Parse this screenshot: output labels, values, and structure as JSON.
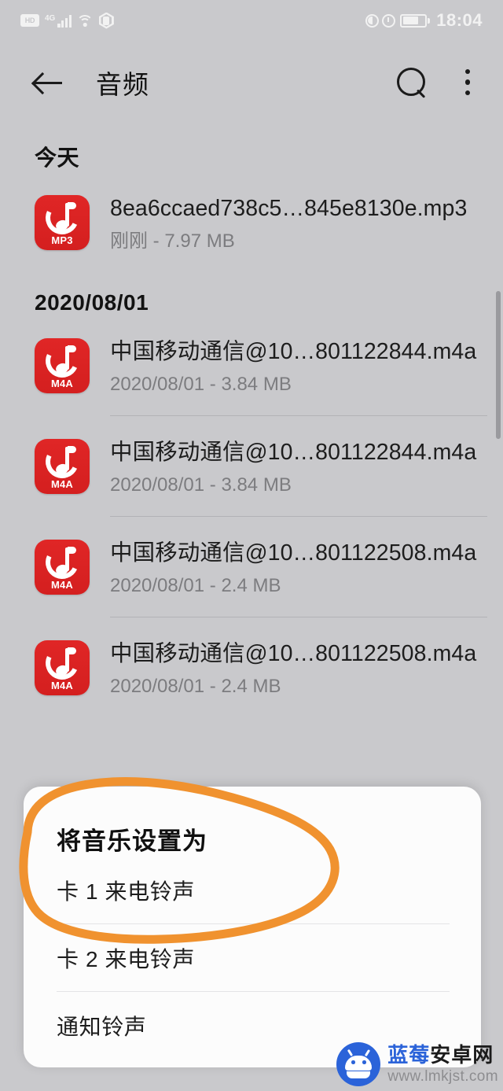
{
  "status_bar": {
    "hd_label": "HD",
    "network": "4G",
    "time": "18:04",
    "icons": [
      "hd-badge-icon",
      "signal-bars-icon",
      "wifi-icon",
      "hexagon-shield-icon",
      "sound-icon",
      "alarm-clock-icon",
      "battery-icon"
    ]
  },
  "app_bar": {
    "title": "音频",
    "back_icon": "back-arrow-icon",
    "search_icon": "search-icon",
    "more_icon": "overflow-menu-icon"
  },
  "sections": [
    {
      "header": "今天",
      "files": [
        {
          "name": "8ea6ccaed738c5…845e8130e.mp3",
          "meta": "刚刚 - 7.97 MB",
          "ext": "MP3",
          "date": "刚刚",
          "size": "7.97 MB"
        }
      ]
    },
    {
      "header": "2020/08/01",
      "files": [
        {
          "name": "中国移动通信@10…801122844.m4a",
          "meta": "2020/08/01 - 3.84 MB",
          "ext": "M4A",
          "date": "2020/08/01",
          "size": "3.84 MB"
        },
        {
          "name": "中国移动通信@10…801122844.m4a",
          "meta": "2020/08/01 - 3.84 MB",
          "ext": "M4A",
          "date": "2020/08/01",
          "size": "3.84 MB"
        },
        {
          "name": "中国移动通信@10…801122508.m4a",
          "meta": "2020/08/01 - 2.4 MB",
          "ext": "M4A",
          "date": "2020/08/01",
          "size": "2.4 MB"
        },
        {
          "name": "中国移动通信@10…801122508.m4a",
          "meta": "2020/08/01 - 2.4 MB",
          "ext": "M4A",
          "date": "2020/08/01",
          "size": "2.4 MB"
        }
      ]
    }
  ],
  "bottom_sheet": {
    "title": "将音乐设置为",
    "options": [
      {
        "label": "卡 1 来电铃声"
      },
      {
        "label": "卡 2 来电铃声"
      },
      {
        "label": "通知铃声"
      }
    ]
  },
  "annotation": {
    "shape": "hand-drawn-oval",
    "color": "#f0922f",
    "targets": [
      "将音乐设置为",
      "卡 1 来电铃声"
    ]
  },
  "watermark": {
    "site_name_part1": "蓝莓",
    "site_name_part2": "安卓网",
    "url": "www.lmkjst.com",
    "logo_icon": "android-robot-icon"
  },
  "colors": {
    "background": "#c9c9cc",
    "sheet": "#fcfcfc",
    "file_icon_red": "#d8201f",
    "annotation_orange": "#f0922f",
    "watermark_blue": "#2b63d9"
  }
}
